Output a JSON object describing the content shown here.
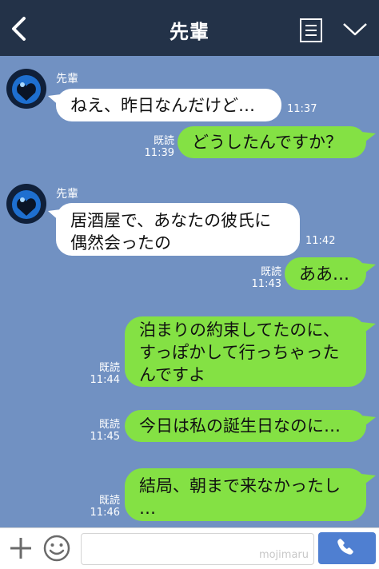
{
  "header": {
    "title": "先輩",
    "colors": {
      "bar": "#233248",
      "background": "#7191c2"
    }
  },
  "messages": [
    {
      "id": "m1",
      "direction": "in",
      "sender": "先輩",
      "text": "ねえ、昨日なんだけど…",
      "time": "11:37"
    },
    {
      "id": "m2",
      "direction": "out",
      "read": "既読",
      "text": "どうしたんですか？",
      "time": "11:39"
    },
    {
      "id": "m3",
      "direction": "in",
      "sender": "先輩",
      "lines": [
        "居酒屋で、あなたの彼氏に",
        "偶然会ったの"
      ],
      "time": "11:42"
    },
    {
      "id": "m4",
      "direction": "out",
      "read": "既読",
      "text": "ああ…",
      "time": "11:43"
    },
    {
      "id": "m5",
      "direction": "out",
      "read": "既読",
      "lines": [
        "泊まりの約束してたのに、",
        "すっぽかして行っちゃった",
        "んですよ"
      ],
      "time": "11:44"
    },
    {
      "id": "m6",
      "direction": "out",
      "read": "既読",
      "text": "今日は私の誕生日なのに…",
      "time": "11:45"
    },
    {
      "id": "m7",
      "direction": "out",
      "read": "既読",
      "lines": [
        "結局、朝まで来なかったし",
        "…"
      ],
      "time": "11:46"
    }
  ],
  "footer": {
    "watermark": "mojimaru",
    "icons": [
      "plus-icon",
      "smile-icon",
      "phone-icon"
    ],
    "colors": {
      "send": "#4f7fd1"
    }
  },
  "bubble_colors": {
    "incoming": "#ffffff",
    "outgoing": "#84e144"
  }
}
